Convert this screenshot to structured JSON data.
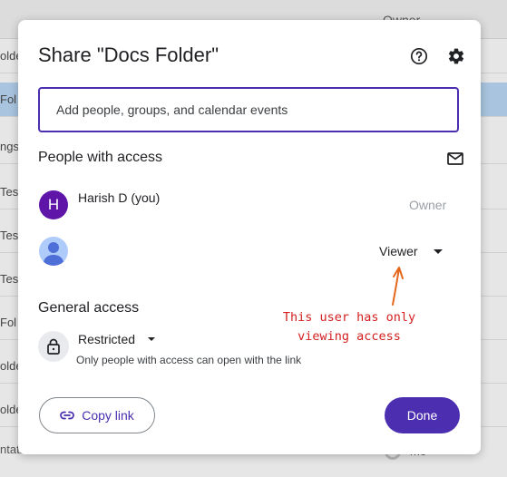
{
  "background": {
    "owner_column_label": "Owner",
    "rows": [
      "olde",
      "Fol",
      "ngs",
      "Tes",
      "Tes",
      "Tes",
      "Fol",
      "olde",
      "olde"
    ],
    "bottom_row_text": "ntation Name",
    "bottom_row_owner": "me"
  },
  "dialog": {
    "title": "Share \"Docs Folder\"",
    "help_icon": "help-icon",
    "settings_icon": "gear-icon",
    "add_people_placeholder": "Add people, groups, and calendar events",
    "people_section_title": "People with access",
    "email_icon": "mail-icon",
    "people": [
      {
        "avatar_letter": "H",
        "avatar_color": "#5f15a8",
        "name": "Harish D (you)",
        "role": "Owner"
      },
      {
        "avatar_icon": "person-icon",
        "avatar_color": "#aecbfa",
        "name": "",
        "role": "Viewer"
      }
    ],
    "general_access_title": "General access",
    "access_level": "Restricted",
    "access_description": "Only people with access can open with the link",
    "copy_link_label": "Copy link",
    "done_label": "Done"
  },
  "annotation": {
    "line1": "This  user has only",
    "line2": "viewing access",
    "color": "#d42020"
  },
  "colors": {
    "accent": "#4b2fb0",
    "selected_row": "#a9c4df"
  }
}
